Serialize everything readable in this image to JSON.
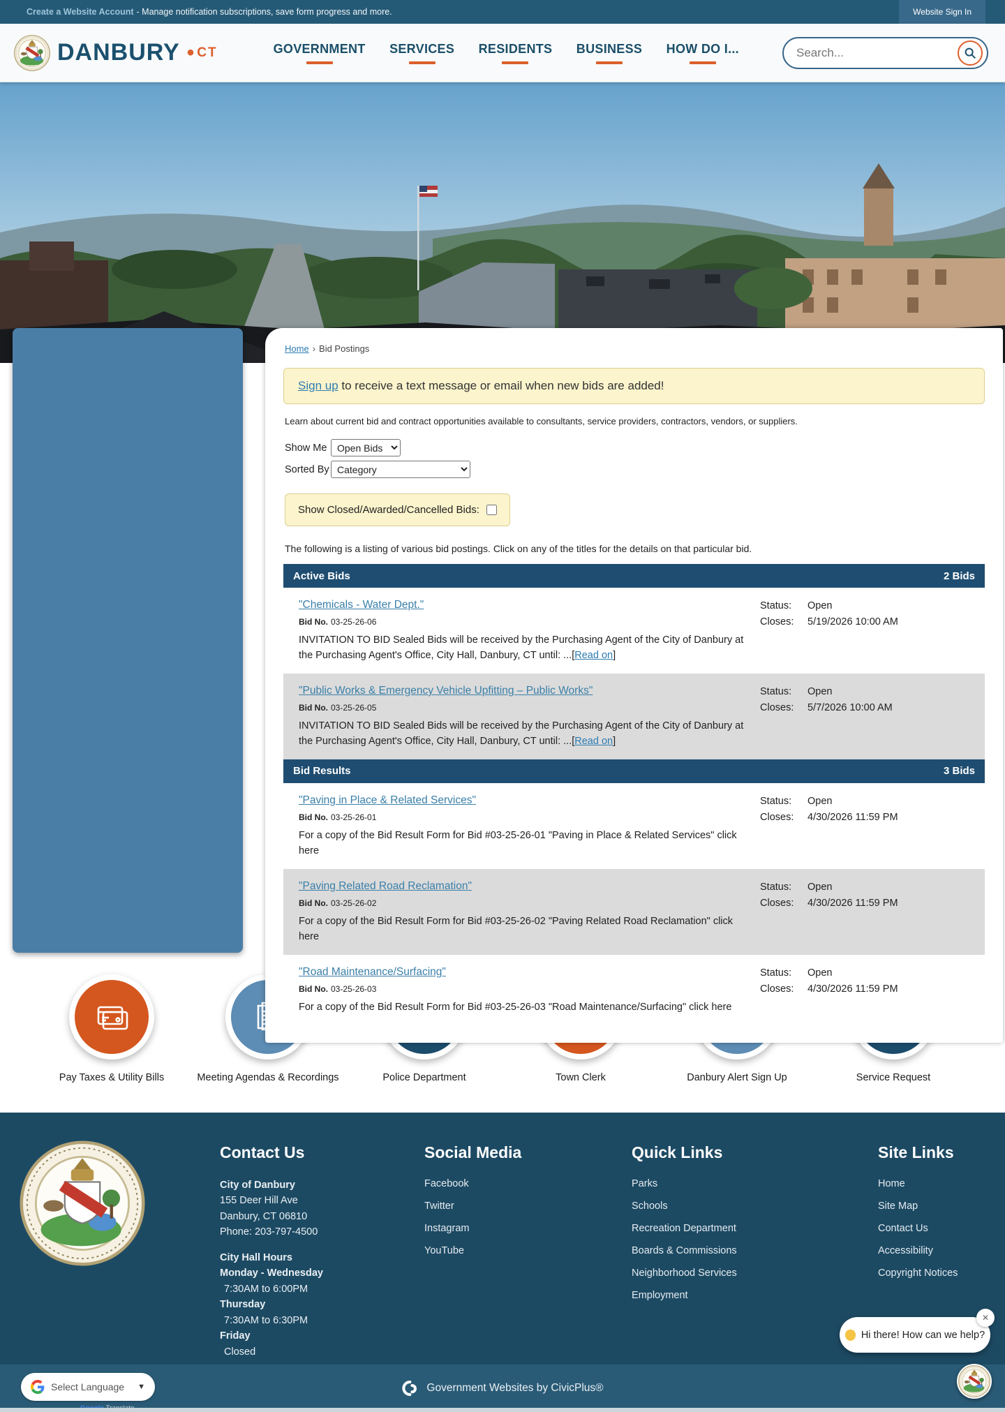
{
  "top_bar": {
    "account_link": "Create a Website Account",
    "account_rest": "- Manage notification subscriptions, save form progress and more.",
    "sign_in": "Website Sign In"
  },
  "header": {
    "city": "DANBURY",
    "dot": "•",
    "state": "CT",
    "nav": [
      {
        "label": "GOVERNMENT"
      },
      {
        "label": "SERVICES"
      },
      {
        "label": "RESIDENTS"
      },
      {
        "label": "BUSINESS"
      },
      {
        "label": "HOW DO I..."
      }
    ],
    "search_placeholder": "Search..."
  },
  "breadcrumb": {
    "home": "Home",
    "separator": "›",
    "current": "Bid Postings"
  },
  "signup": {
    "link": "Sign up",
    "rest": " to receive a text message or email when new bids are added!"
  },
  "intro": "Learn about current bid and contract opportunities available to consultants, service providers, contractors, vendors, or suppliers.",
  "filters": {
    "show_me_label": "Show Me",
    "show_me_value": "Open Bids",
    "sorted_by_label": "Sorted By",
    "sorted_by_value": "Category",
    "closed_label": "Show Closed/Awarded/Cancelled Bids:"
  },
  "listing_note": "The following is a listing of various bid postings. Click on any of the titles for the details on that particular bid.",
  "sections": [
    {
      "title": "Active Bids",
      "count": "2 Bids",
      "rows": [
        {
          "title": "\"Chemicals - Water Dept.\"",
          "bid_no_label": "Bid No.",
          "bid_no": "03-25-26-06",
          "desc_pre": "INVITATION TO BID Sealed Bids will be received by the Purchasing Agent of the City of Danbury at the Purchasing Agent's Office, City Hall, Danbury, CT until:  ...[",
          "read_on": "Read on",
          "desc_post": "]",
          "status_label": "Status:",
          "status": "Open",
          "closes_label": "Closes:",
          "closes": "5/19/2026 10:00 AM"
        },
        {
          "title": "\"Public Works & Emergency Vehicle Upfitting – Public Works\"",
          "bid_no_label": "Bid No.",
          "bid_no": "03-25-26-05",
          "desc_pre": "INVITATION TO BID Sealed Bids will be received by the Purchasing Agent of the City of Danbury at the Purchasing Agent's Office, City Hall, Danbury, CT until:  ...[",
          "read_on": "Read on",
          "desc_post": "]",
          "status_label": "Status:",
          "status": "Open",
          "closes_label": "Closes:",
          "closes": "5/7/2026 10:00 AM"
        }
      ]
    },
    {
      "title": "Bid Results",
      "count": "3 Bids",
      "rows": [
        {
          "title": "\"Paving in Place & Related Services\"",
          "bid_no_label": "Bid No.",
          "bid_no": "03-25-26-01",
          "desc_pre": "For a copy of the Bid Result Form for Bid #03-25-26-01 \"Paving in Place & Related Services\" click here",
          "read_on": "",
          "desc_post": "",
          "status_label": "Status:",
          "status": "Open",
          "closes_label": "Closes:",
          "closes": "4/30/2026 11:59 PM"
        },
        {
          "title": "\"Paving Related Road Reclamation\"",
          "bid_no_label": "Bid No.",
          "bid_no": "03-25-26-02",
          "desc_pre": "For a copy of the Bid Result Form for Bid #03-25-26-02 \"Paving Related Road Reclamation\" click here",
          "read_on": "",
          "desc_post": "",
          "status_label": "Status:",
          "status": "Open",
          "closes_label": "Closes:",
          "closes": "4/30/2026 11:59 PM"
        },
        {
          "title": "\"Road Maintenance/Surfacing\"",
          "bid_no_label": "Bid No.",
          "bid_no": "03-25-26-03",
          "desc_pre": "For a copy of the Bid Result Form for Bid #03-25-26-03 \"Road Maintenance/Surfacing\" click here",
          "read_on": "",
          "desc_post": "",
          "status_label": "Status:",
          "status": "Open",
          "closes_label": "Closes:",
          "closes": "4/30/2026 11:59 PM"
        }
      ]
    }
  ],
  "quick_access": [
    {
      "label": "Pay Taxes & Utility Bills",
      "color": "#d4571f",
      "icon": "credit-card-icon"
    },
    {
      "label": "Meeting Agendas & Recordings",
      "color": "#5d8cb4",
      "icon": "documents-icon"
    },
    {
      "label": "Police Department",
      "color": "#1c4c6c",
      "icon": "police-badge-icon"
    },
    {
      "label": "Town Clerk",
      "color": "#d4571f",
      "icon": "folder-icon"
    },
    {
      "label": "Danbury Alert Sign Up",
      "color": "#5d8cb4",
      "icon": "mobile-phone-icon"
    },
    {
      "label": "Service Request",
      "color": "#1c4c6c",
      "icon": "clipboard-check-icon"
    }
  ],
  "footer": {
    "contact": {
      "heading": "Contact Us",
      "org": "City of Danbury",
      "addr1": "155 Deer Hill Ave",
      "addr2": "Danbury, CT 06810",
      "phone": "Phone: 203-797-4500",
      "hours_heading": "City Hall Hours",
      "d1": "Monday - Wednesday",
      "d1v": "7:30AM to 6:00PM",
      "d2": "Thursday",
      "d2v": "7:30AM to 6:30PM",
      "d3": "Friday",
      "d3v": "Closed"
    },
    "social": {
      "heading": "Social Media",
      "links": [
        "Facebook",
        "Twitter",
        "Instagram",
        "YouTube"
      ]
    },
    "quick": {
      "heading": "Quick Links",
      "links": [
        "Parks",
        "Schools",
        "Recreation Department",
        "Boards & Commissions",
        "Neighborhood Services",
        "Employment"
      ]
    },
    "site": {
      "heading": "Site Links",
      "links": [
        "Home",
        "Site Map",
        "Contact Us",
        "Accessibility",
        "Copyright Notices"
      ]
    }
  },
  "bottom_bar": {
    "select_language": "Select Language",
    "google_attr_brand": "Google",
    "google_attr_rest": " Translate",
    "civicplus": "Government Websites by CivicPlus®"
  },
  "chat": {
    "message": "Hi there! How can we help?",
    "close": "✕"
  }
}
